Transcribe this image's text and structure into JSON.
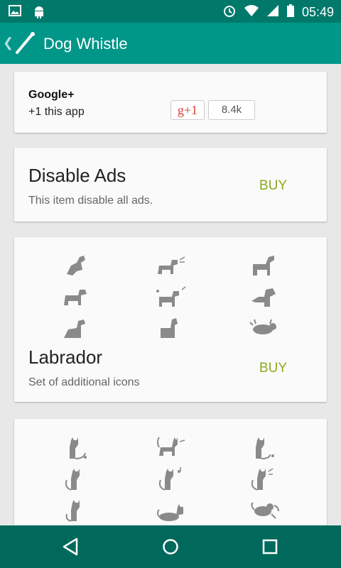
{
  "status_bar": {
    "time": "05:49",
    "left_icons": [
      "image-icon",
      "android-icon"
    ],
    "right_icons": [
      "alarm-icon",
      "wifi-icon",
      "signal-icon",
      "battery-icon"
    ]
  },
  "app_bar": {
    "title": "Dog Whistle"
  },
  "google_plus": {
    "title": "Google+",
    "subtitle": "+1 this app",
    "button_label": "g+1",
    "count": "8.4k"
  },
  "disable_ads": {
    "title": "Disable Ads",
    "description": "This item disable all ads.",
    "buy_label": "BUY"
  },
  "labrador": {
    "title": "Labrador",
    "description": "Set of additional icons",
    "buy_label": "BUY",
    "icons": [
      "dog-jumping-icon",
      "dog-barking-icon",
      "dog-howling-icon",
      "dog-standing-icon",
      "dog-music-icon",
      "dog-angry-icon",
      "dog-sitting-icon",
      "dog-begging-icon",
      "dog-lying-icon"
    ]
  },
  "cat_pack": {
    "icons": [
      "cat-sitting-icon",
      "cat-standing-icon",
      "cat-sitting-2-icon",
      "cat-tail-icon",
      "cat-singing-icon",
      "cat-meowing-icon",
      "cat-looking-icon",
      "cat-lying-icon",
      "cat-playing-icon"
    ]
  },
  "colors": {
    "status_bar": "#00796b",
    "app_bar": "#009688",
    "nav_bar": "#00695c",
    "buy_text": "#8bab1f",
    "icon_gray": "#8a8a8a"
  }
}
